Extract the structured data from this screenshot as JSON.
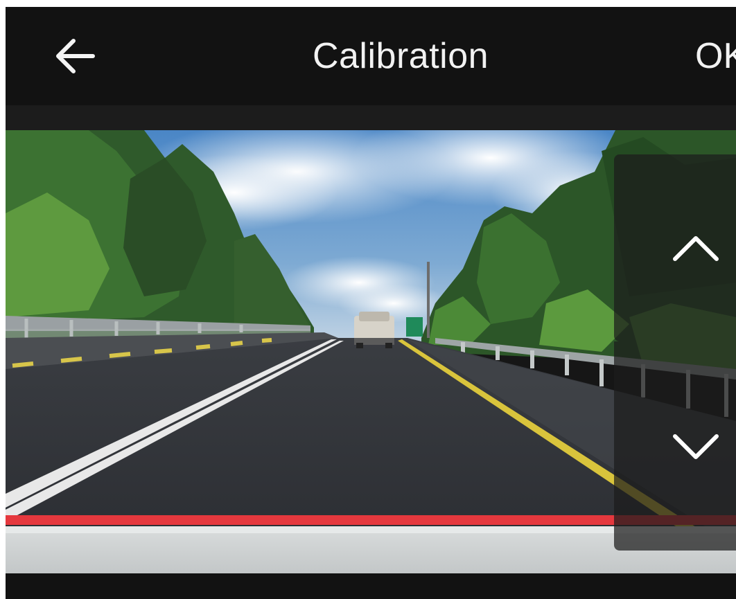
{
  "header": {
    "back_icon": "arrow-left-icon",
    "title": "Calibration",
    "ok_label": "OK"
  },
  "calibration": {
    "horizon_line_color": "#e5383e",
    "up_icon": "chevron-up-icon",
    "down_icon": "chevron-down-icon"
  },
  "colors": {
    "bar_background": "#121212",
    "text": "#f2f2f2",
    "control_overlay": "rgba(28,28,28,0.72)"
  }
}
